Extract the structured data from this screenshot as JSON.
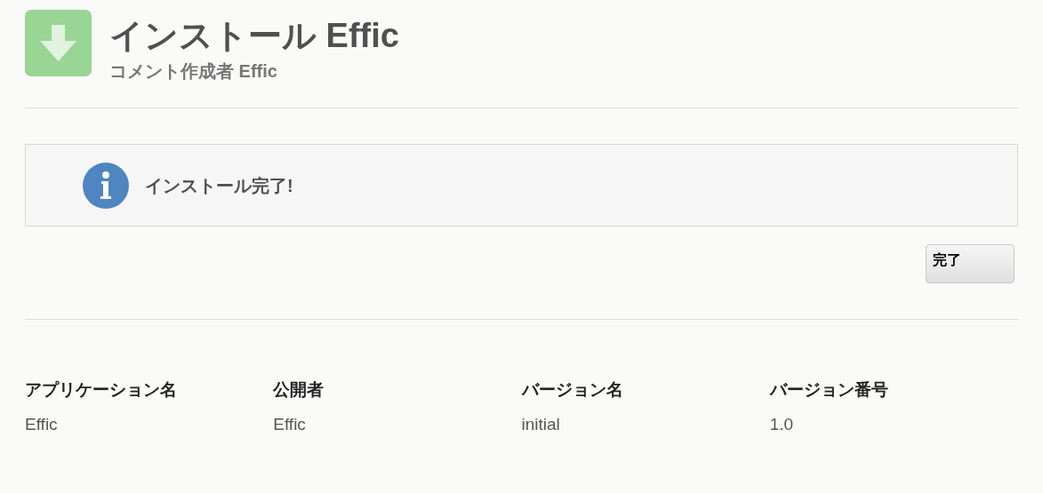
{
  "header": {
    "title": "インストール Effic",
    "subtitle": "コメント作成者 Effic"
  },
  "message": {
    "text": "インストール完了!"
  },
  "buttons": [
    "完了"
  ],
  "details": [
    {
      "label": "アプリケーション名",
      "value": "Effic"
    },
    {
      "label": "公開者",
      "value": "Effic"
    },
    {
      "label": "バージョン名",
      "value": "initial"
    },
    {
      "label": "バージョン番号",
      "value": "1.0"
    }
  ]
}
